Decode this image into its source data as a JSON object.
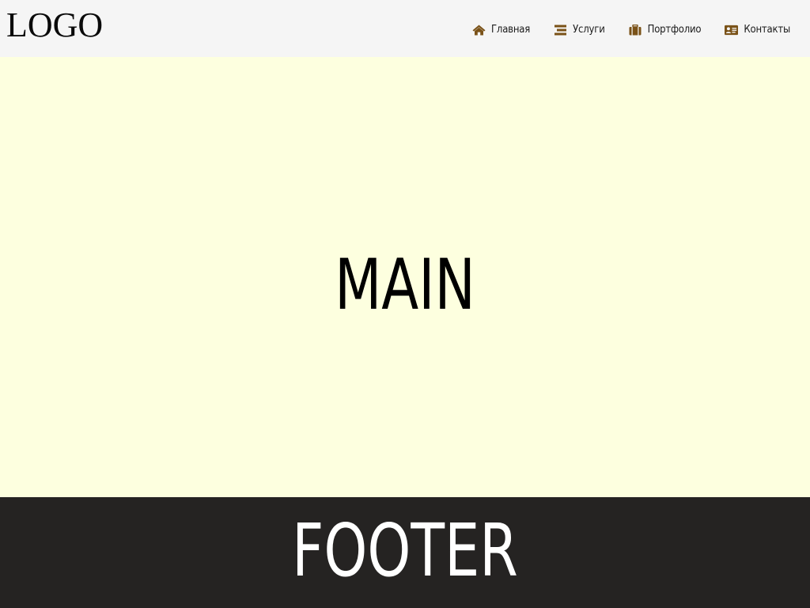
{
  "header": {
    "logo": "LOGO",
    "nav": [
      {
        "label": "Главная",
        "icon": "home-icon"
      },
      {
        "label": "Услуги",
        "icon": "list-icon"
      },
      {
        "label": "Портфолио",
        "icon": "briefcase-icon"
      },
      {
        "label": "Контакты",
        "icon": "contact-card-icon"
      }
    ]
  },
  "main": {
    "title": "MAIN"
  },
  "footer": {
    "title": "FOOTER"
  },
  "colors": {
    "header_bg": "#f5f5f5",
    "main_bg": "#fdffdf",
    "footer_bg": "#252322",
    "icon_accent": "#7a5218"
  }
}
